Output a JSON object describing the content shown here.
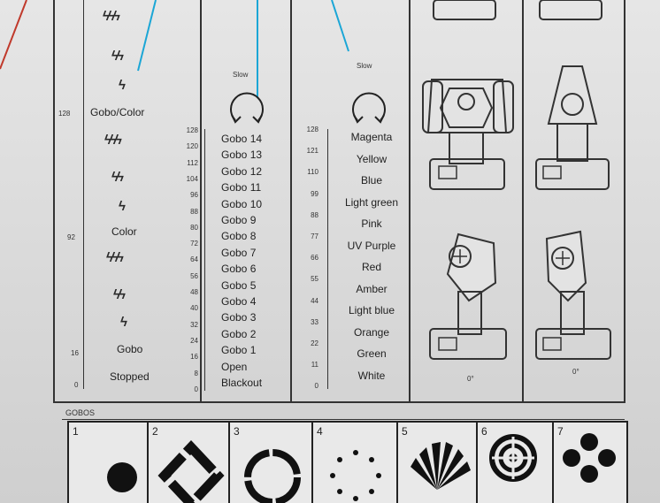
{
  "column1": {
    "speed_levels": [
      "ϟϟϟ",
      "ϟϟ",
      "ϟ"
    ],
    "mode_labels": [
      "Gobo/Color",
      "Color",
      "Gobo",
      "Stopped"
    ],
    "scale": [
      "128",
      "92",
      "16",
      "0"
    ]
  },
  "column2": {
    "slow_label": "Slow",
    "scale": [
      "128",
      "120",
      "112",
      "104",
      "96",
      "88",
      "80",
      "72",
      "64",
      "56",
      "48",
      "40",
      "32",
      "24",
      "16",
      "8",
      "0"
    ],
    "items": [
      "Gobo 14",
      "Gobo 13",
      "Gobo 12",
      "Gobo 11",
      "Gobo 10",
      "Gobo 9",
      "Gobo 8",
      "Gobo 7",
      "Gobo 6",
      "Gobo 5",
      "Gobo 4",
      "Gobo 3",
      "Gobo 2",
      "Gobo 1",
      "Open",
      "Blackout"
    ]
  },
  "column3": {
    "slow_label": "Slow",
    "scale": [
      "128",
      "121",
      "110",
      "99",
      "88",
      "77",
      "66",
      "55",
      "44",
      "33",
      "22",
      "11",
      "0"
    ],
    "items": [
      "Magenta",
      "Yellow",
      "Blue",
      "Light green",
      "Pink",
      "UV Purple",
      "Red",
      "Amber",
      "Light blue",
      "Orange",
      "Green",
      "White"
    ]
  },
  "fixture_angles": [
    "0°",
    "0°"
  ],
  "gobos": {
    "title": "GOBOS",
    "numbers": [
      "1",
      "2",
      "3",
      "4",
      "5",
      "6",
      "7"
    ]
  },
  "colors": {
    "line": "#333333",
    "accent": "#1ba6d6",
    "red": "#c0392b"
  }
}
